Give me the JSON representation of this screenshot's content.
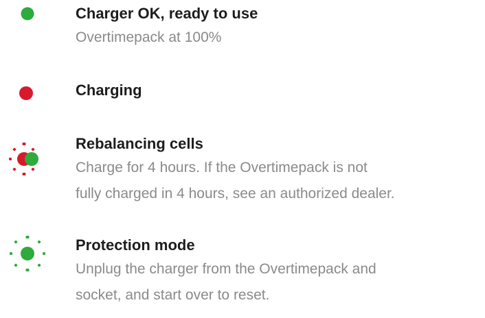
{
  "colors": {
    "green": "#2dab3c",
    "red": "#d8192c",
    "title": "#1d1d1f",
    "description": "#8a8a8a"
  },
  "statuses": [
    {
      "indicator": "solid-green-light",
      "title": "Charger OK, ready to use",
      "lines": [
        "Overtimepack at 100%"
      ]
    },
    {
      "indicator": "solid-red-light",
      "title": "Charging",
      "lines": []
    },
    {
      "indicator": "flashing-red-green-light",
      "title": "Rebalancing cells",
      "lines": [
        "Charge for 4 hours. If the Overtimepack is not",
        "fully charged in 4 hours, see an authorized dealer."
      ]
    },
    {
      "indicator": "flashing-green-light",
      "title": "Protection mode",
      "lines": [
        "Unplug the charger from the Overtimepack and",
        "socket, and start over to reset."
      ]
    }
  ]
}
